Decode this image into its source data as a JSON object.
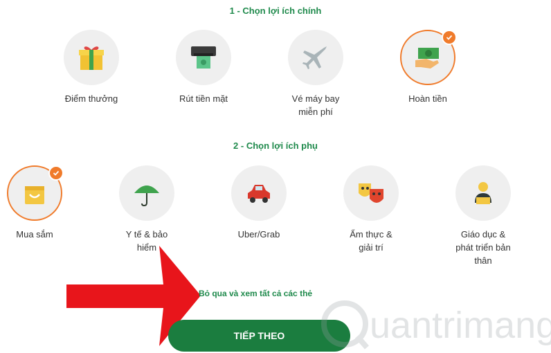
{
  "section1": {
    "title": "1 - Chọn lợi ích chính",
    "options": [
      {
        "label": "Điểm thưởng",
        "icon": "gift-icon",
        "selected": false
      },
      {
        "label": "Rút tiền mặt",
        "icon": "atm-cash-icon",
        "selected": false
      },
      {
        "label": "Vé máy bay miễn phí",
        "icon": "airplane-icon",
        "selected": false
      },
      {
        "label": "Hoàn tiền",
        "icon": "cashback-hand-icon",
        "selected": true
      }
    ]
  },
  "section2": {
    "title": "2 - Chọn lợi ích phụ",
    "options": [
      {
        "label": "Mua sắm",
        "icon": "shopping-bag-icon",
        "selected": true
      },
      {
        "label": "Y tế & bảo hiểm",
        "icon": "umbrella-icon",
        "selected": false
      },
      {
        "label": "Uber/Grab",
        "icon": "car-icon",
        "selected": false
      },
      {
        "label": "Ẩm thực & giải trí",
        "icon": "theater-masks-icon",
        "selected": false
      },
      {
        "label": "Giáo dục & phát triển bản thân",
        "icon": "person-laptop-icon",
        "selected": false
      }
    ]
  },
  "skip_link": "Bỏ qua và xem tất cả các thẻ",
  "next_button": "TIẾP THEO",
  "watermark_text": "uantrimang",
  "colors": {
    "accent_green": "#1f8a4c",
    "button_green": "#1b7d3f",
    "selected_orange": "#f07b2b",
    "arrow_red": "#e8151b"
  }
}
